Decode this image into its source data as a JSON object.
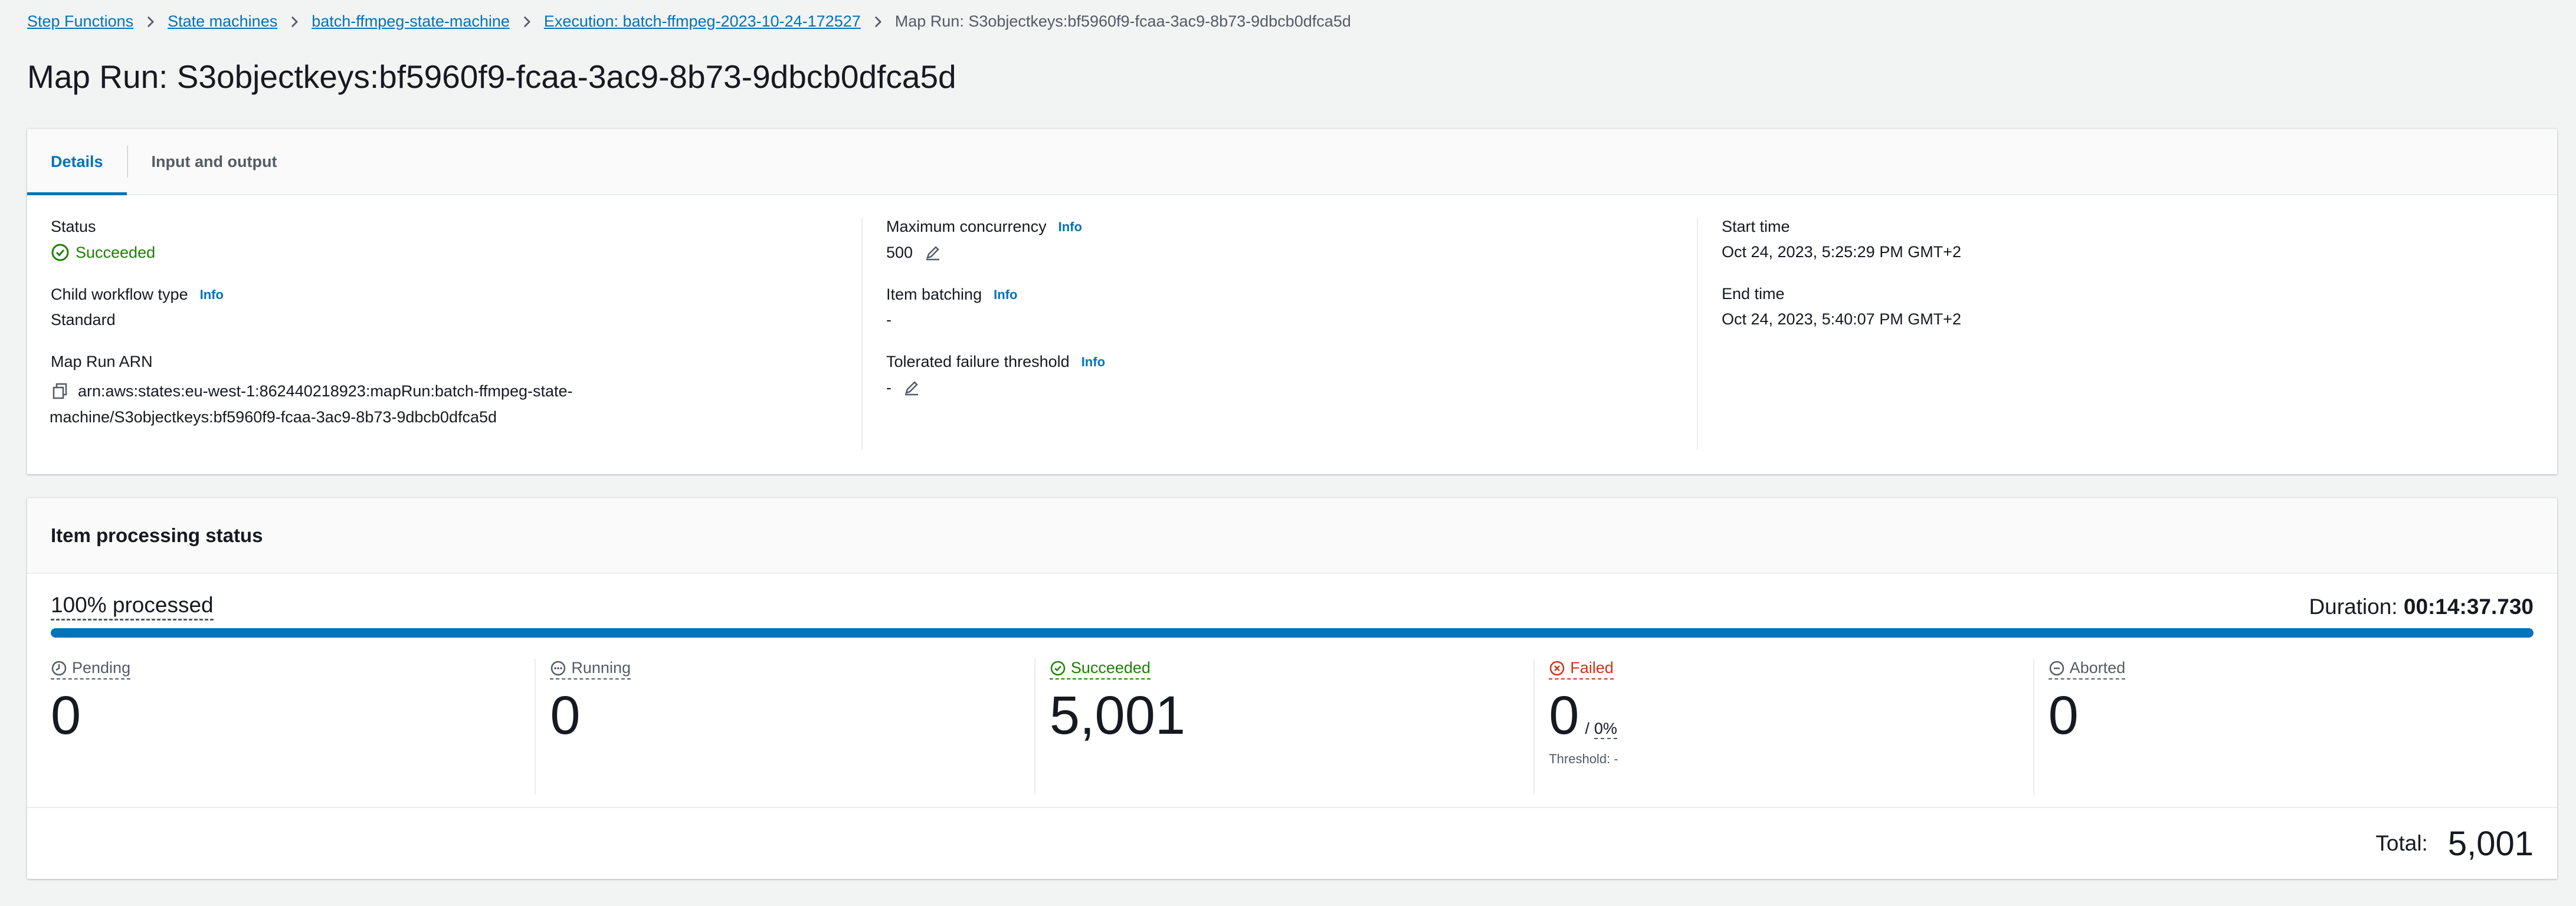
{
  "breadcrumb": {
    "items": [
      "Step Functions",
      "State machines",
      "batch-ffmpeg-state-machine",
      "Execution: batch-ffmpeg-2023-10-24-172527"
    ],
    "current": "Map Run: S3objectkeys:bf5960f9-fcaa-3ac9-8b73-9dbcb0dfca5d"
  },
  "page_title": "Map Run: S3objectkeys:bf5960f9-fcaa-3ac9-8b73-9dbcb0dfca5d",
  "tabs": [
    "Details",
    "Input and output"
  ],
  "details": {
    "info_label": "Info",
    "status_label": "Status",
    "status_value": "Succeeded",
    "child_workflow_label": "Child workflow type",
    "child_workflow_value": "Standard",
    "map_run_arn_label": "Map Run ARN",
    "map_run_arn_line1": "arn:aws:states:eu-west-1:862440218923:mapRun:batch-ffmpeg-state-",
    "map_run_arn_line2": "machine/S3objectkeys:bf5960f9-fcaa-3ac9-8b73-9dbcb0dfca5d",
    "max_concurrency_label": "Maximum concurrency",
    "max_concurrency_value": "500",
    "item_batching_label": "Item batching",
    "item_batching_value": "-",
    "tolerated_failure_label": "Tolerated failure threshold",
    "tolerated_failure_value": "-",
    "start_time_label": "Start time",
    "start_time_value": "Oct 24, 2023, 5:25:29 PM GMT+2",
    "end_time_label": "End time",
    "end_time_value": "Oct 24, 2023, 5:40:07 PM GMT+2"
  },
  "processing": {
    "title": "Item processing status",
    "processed_label": "100% processed",
    "progress_percent": 100,
    "duration_label": "Duration:",
    "duration_value": "00:14:37.730",
    "counters": {
      "pending_label": "Pending",
      "pending_value": "0",
      "running_label": "Running",
      "running_value": "0",
      "succeeded_label": "Succeeded",
      "succeeded_value": "5,001",
      "failed_label": "Failed",
      "failed_value": "0",
      "failed_sep": "/",
      "failed_pct": "0%",
      "threshold_text": "Threshold: -",
      "aborted_label": "Aborted",
      "aborted_value": "0"
    },
    "total_label": "Total:",
    "total_value": "5,001"
  },
  "colors": {
    "link": "#0073bb",
    "success": "#1d8102",
    "error": "#d13212",
    "progress": "#0073bb"
  },
  "icons": [
    "chevron-right-icon",
    "check-circle-icon",
    "copy-icon",
    "edit-icon",
    "clock-icon",
    "ellipsis-circle-icon",
    "x-circle-icon",
    "minus-circle-icon"
  ]
}
